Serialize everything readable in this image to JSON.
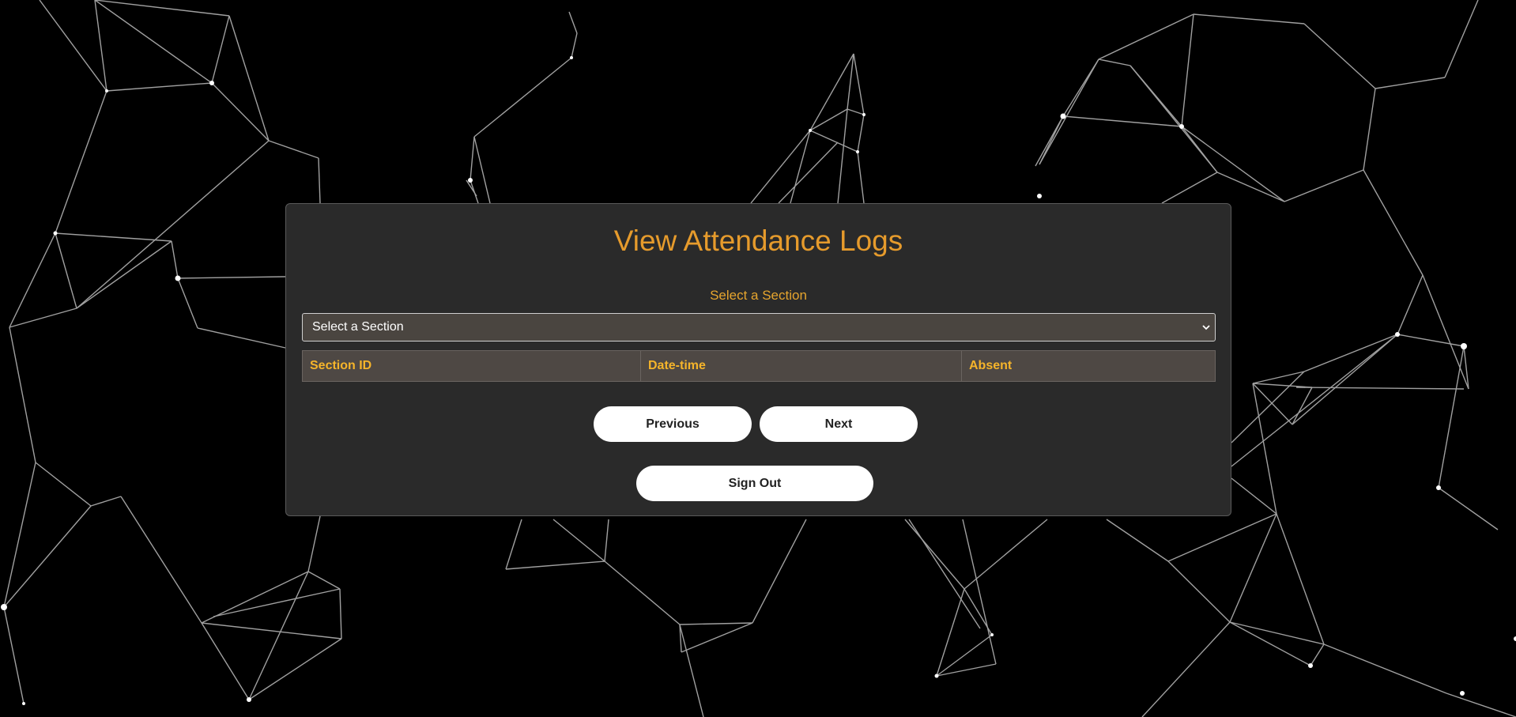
{
  "page": {
    "title": "View Attendance Logs"
  },
  "section_select": {
    "label": "Select a Section",
    "selected_value": "Select a Section",
    "chevron_icon": "chevron-down-icon"
  },
  "table": {
    "headers": [
      "Section ID",
      "Date-time",
      "Absent"
    ],
    "rows": []
  },
  "pagination": {
    "previous_label": "Previous",
    "next_label": "Next"
  },
  "account": {
    "sign_out_label": "Sign Out"
  },
  "colors": {
    "background": "#000000",
    "panel": "#2a2a2a",
    "accent": "#e69b2c",
    "header_text": "#f5b42a",
    "button": "#ffffff"
  }
}
